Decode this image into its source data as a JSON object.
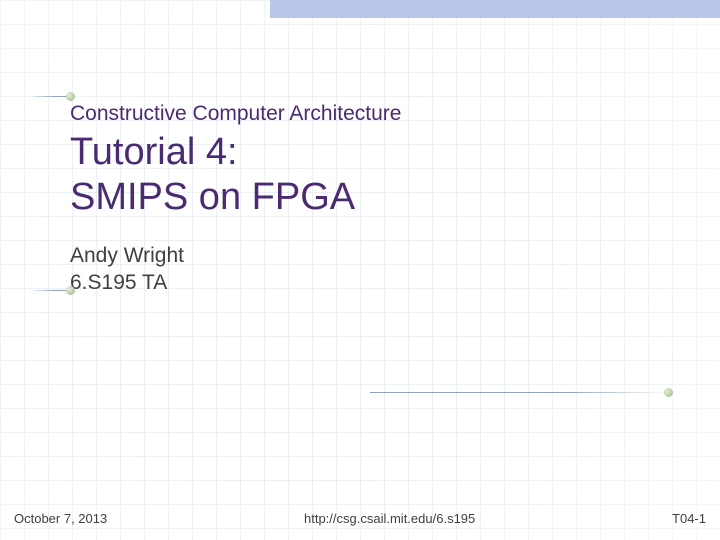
{
  "header": {
    "subtitle": "Constructive Computer Architecture",
    "title_line1": "Tutorial 4:",
    "title_line2": "SMIPS on FPGA"
  },
  "author": {
    "name": "Andy Wright",
    "role": "6.S195 TA"
  },
  "footer": {
    "date": "October 7, 2013",
    "url": "http://csg.csail.mit.edu/6.s195",
    "slide_id": "T04-1"
  }
}
